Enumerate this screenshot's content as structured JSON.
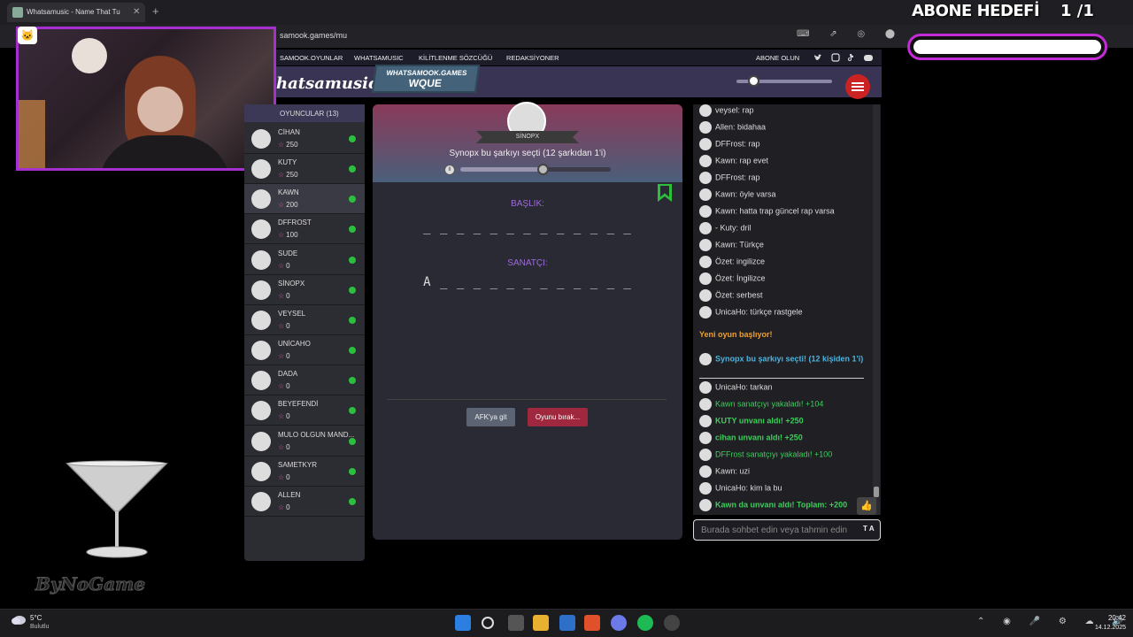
{
  "browser": {
    "tab_title": "Whatsamusic - Name That Tu",
    "url": "samook.games/mu",
    "addr_icons": "⌨ ⇗ ◎ ⬤",
    "tab_close_icon": "✕",
    "new_tab_icon": "+"
  },
  "stream_overlay": {
    "goal_title": "ABONE HEDEFİ",
    "goal_count": "1 /1",
    "watermark": "ByNoGame"
  },
  "site": {
    "nav": [
      "SAMOOK.OYUNLAR",
      "WHATSAMUSIC",
      "KİLİTLENME SÖZCÜĞÜ",
      "REDAKSİYONER",
      "ABONE OLUN"
    ],
    "logo": "hatsamusic",
    "room_tag_top": "WHATSAMOOK.GAMES",
    "room_tag_bottom": "WQUE",
    "volume": 0.18
  },
  "players": {
    "header": "OYUNCULAR (13)",
    "list": [
      {
        "name": "CİHAN",
        "score": "250",
        "active": false
      },
      {
        "name": "KUTY",
        "score": "250",
        "active": false
      },
      {
        "name": "KAWN",
        "score": "200",
        "active": true
      },
      {
        "name": "DFFROST",
        "score": "100",
        "active": false
      },
      {
        "name": "SUDE",
        "score": "0",
        "active": false
      },
      {
        "name": "SİNOPX",
        "score": "0",
        "active": false
      },
      {
        "name": "VEYSEL",
        "score": "0",
        "active": false
      },
      {
        "name": "UNİCAHO",
        "score": "0",
        "active": false
      },
      {
        "name": "DADA",
        "score": "0",
        "active": false
      },
      {
        "name": "BEYEFENDİ",
        "score": "0",
        "active": false
      },
      {
        "name": "MULO OLGUN MAND...",
        "score": "0",
        "active": false
      },
      {
        "name": "SAMETKYR",
        "score": "0",
        "active": false
      },
      {
        "name": "ALLEN",
        "score": "0",
        "active": false
      }
    ]
  },
  "game": {
    "chooser_name": "SİNOPX",
    "chose_text": "Synopx bu şarkıyı seçti (12 şarkıdan 1'i)",
    "progress": 0.55,
    "title_label": "BAŞLIK:",
    "title_blanks": "_ _ _ _ _ _ _ _ _ _ _ _ _",
    "artist_label": "SANATÇI:",
    "artist_blanks": "A _ _ _ _ _ _ _ _ _ _ _ _",
    "afk_label": "AFK'ya git",
    "quit_label": "Oyunu bırak..."
  },
  "chat": {
    "messages_top": [
      "veysel: rap",
      "Allen: bidahaa",
      "DFFrost: rap",
      "Kawn: rap evet",
      "DFFrost: rap",
      "Kawn: öyle varsa",
      "Kawn: hatta trap güncel rap varsa",
      "- Kuty: dril",
      "Kawn: Türkçe",
      "Özet: ingilizce",
      "Özet: İngilizce",
      "Özet: serbest",
      "UnicaHo: türkçe rastgele"
    ],
    "new_game": "Yeni oyun başlıyor!",
    "chose_msg": "Synopx bu şarkıyı seçti! (12 kişiden 1'i)",
    "messages_bottom": [
      {
        "text": "UnicaHo: tarkan",
        "style": "plain"
      },
      {
        "text": "Kawn sanatçıyı yakaladı! +104",
        "style": "greenplain"
      },
      {
        "text": "KUTY unvanı aldı! +250",
        "style": "green"
      },
      {
        "text": "cihan unvanı aldı! +250",
        "style": "green"
      },
      {
        "text": "DFFrost sanatçıyı yakaladı! +100",
        "style": "greenplain"
      },
      {
        "text": "Kawn: uzi",
        "style": "plain"
      },
      {
        "text": "UnicaHo: kim la bu",
        "style": "plain"
      },
      {
        "text": "Kawn da unvanı aldı! Toplam: +200",
        "style": "green"
      }
    ],
    "input_placeholder": "Burada sohbet edin veya tahmin edin",
    "input_suffix": "T A",
    "thumbs_icon": "👍"
  },
  "taskbar": {
    "temp": "5°C",
    "condition": "Bulutlu",
    "time": "20:42",
    "date": "14.12.2025",
    "tray": "⌃ ◉ 🎤 ⚙ ☁ 🔊"
  }
}
